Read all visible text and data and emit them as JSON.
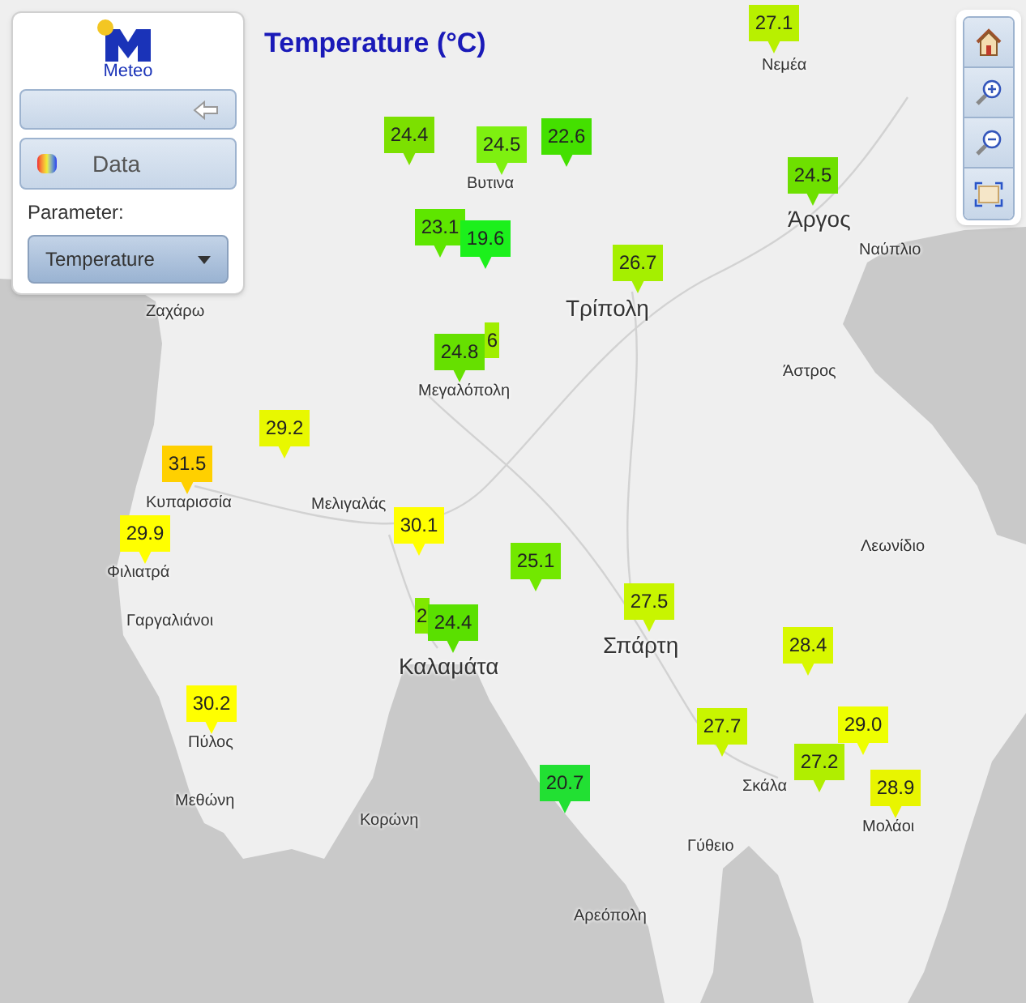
{
  "panel": {
    "logo_text": "Meteo",
    "data_button": "Data",
    "parameter_label": "Parameter:",
    "parameter_select": "Temperature"
  },
  "map": {
    "title": "Temperature (°C)",
    "places": [
      {
        "name": "Νεμέα",
        "kind": "town"
      },
      {
        "name": "Βυτινα",
        "kind": "town"
      },
      {
        "name": "Άργος",
        "kind": "city"
      },
      {
        "name": "Ναύπλιο",
        "kind": "town"
      },
      {
        "name": "Τρίπολη",
        "kind": "city"
      },
      {
        "name": "Ζαχάρω",
        "kind": "town"
      },
      {
        "name": "Μεγαλόπολη",
        "kind": "town"
      },
      {
        "name": "Άστρος",
        "kind": "town"
      },
      {
        "name": "Κυπαρισσία",
        "kind": "town"
      },
      {
        "name": "Μελιγαλάς",
        "kind": "town"
      },
      {
        "name": "Φιλιατρά",
        "kind": "town"
      },
      {
        "name": "Λεωνίδιο",
        "kind": "town"
      },
      {
        "name": "Σπάρτη",
        "kind": "city"
      },
      {
        "name": "Γαργαλιάνοι",
        "kind": "town"
      },
      {
        "name": "Καλαμάτα",
        "kind": "city"
      },
      {
        "name": "Πύλος",
        "kind": "town"
      },
      {
        "name": "Μεθώνη",
        "kind": "town"
      },
      {
        "name": "Κορώνη",
        "kind": "town"
      },
      {
        "name": "Σκάλα",
        "kind": "town"
      },
      {
        "name": "Μολάοι",
        "kind": "town"
      },
      {
        "name": "Γύθειο",
        "kind": "town"
      },
      {
        "name": "Αρεόπολη",
        "kind": "town"
      }
    ],
    "stations": [
      {
        "value": "27.1",
        "color": "#b8f000"
      },
      {
        "value": "24.4",
        "color": "#7ce000"
      },
      {
        "value": "24.5",
        "color": "#7ef010"
      },
      {
        "value": "22.6",
        "color": "#44e000"
      },
      {
        "value": "24.5",
        "color": "#6ee000"
      },
      {
        "value": "23.1",
        "color": "#5ee600"
      },
      {
        "value": "19.6",
        "color": "#1cf01c"
      },
      {
        "value": "26.7",
        "color": "#a5ef00"
      },
      {
        "value": "6",
        "color": "#a0ee00"
      },
      {
        "value": "24.8",
        "color": "#66e000"
      },
      {
        "value": "29.2",
        "color": "#e8f800"
      },
      {
        "value": "31.5",
        "color": "#ffd000"
      },
      {
        "value": "29.9",
        "color": "#ffff00"
      },
      {
        "value": "30.1",
        "color": "#ffff00"
      },
      {
        "value": "25.1",
        "color": "#72e800"
      },
      {
        "value": "27.5",
        "color": "#c8f500"
      },
      {
        "value": "2",
        "color": "#80e800"
      },
      {
        "value": "24.4",
        "color": "#5ae000"
      },
      {
        "value": "28.4",
        "color": "#d8f800"
      },
      {
        "value": "30.2",
        "color": "#ffff00"
      },
      {
        "value": "27.7",
        "color": "#c8f500"
      },
      {
        "value": "29.0",
        "color": "#eeff00"
      },
      {
        "value": "27.2",
        "color": "#b0ee00"
      },
      {
        "value": "20.7",
        "color": "#22e033"
      },
      {
        "value": "28.9",
        "color": "#e8f500"
      }
    ]
  }
}
